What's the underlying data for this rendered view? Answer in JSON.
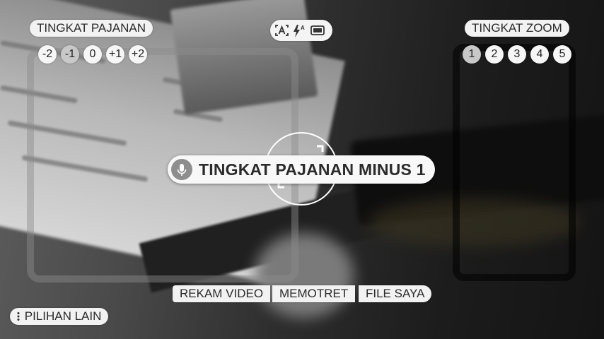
{
  "exposure": {
    "title": "TINGKAT PAJANAN",
    "levels": [
      "-2",
      "-1",
      "0",
      "+1",
      "+2"
    ],
    "selected_index": 1
  },
  "zoom": {
    "title": "TINGKAT ZOOM",
    "levels": [
      "1",
      "2",
      "3",
      "4",
      "5"
    ],
    "selected_index": 0
  },
  "mode_icons": [
    "auto-focus-icon",
    "flash-auto-icon",
    "aspect-ratio-icon"
  ],
  "toast": {
    "icon": "mic-icon",
    "text": "TINGKAT PAJANAN MINUS 1"
  },
  "bottom_actions": {
    "record": "REKAM VIDEO",
    "photo": "MEMOTRET",
    "files": "FILE SAYA"
  },
  "more_options": {
    "icon": "more-vert-icon",
    "label": "PILIHAN LAIN"
  }
}
